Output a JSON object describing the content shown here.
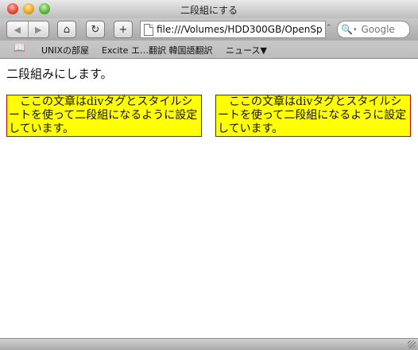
{
  "window": {
    "title": "二段組にする"
  },
  "toolbar": {
    "back_icon": "◀",
    "forward_icon": "▶",
    "home_icon": "⌂",
    "reload_icon": "↻",
    "add_icon": "+",
    "url": "file:///Volumes/HDD300GB/OpenSp",
    "search_placeholder": "Google",
    "search_icon": "🔍",
    "search_arrow": "▾"
  },
  "bookmarks": {
    "book_icon": "📖",
    "items": [
      "UNIXの部屋",
      "Excite エ…翻訳 韓国語翻訳",
      "ニュース▼"
    ]
  },
  "content": {
    "heading": "二段組みにします。",
    "column_left": "ここの文章はdivタグとスタイルシートを使って二段組になるように設定しています。",
    "column_right": "ここの文章はdivタグとスタイルシートを使って二段組になるように設定しています。",
    "column_bg_color": "#ffff00",
    "column_border_color": "#c00000"
  }
}
